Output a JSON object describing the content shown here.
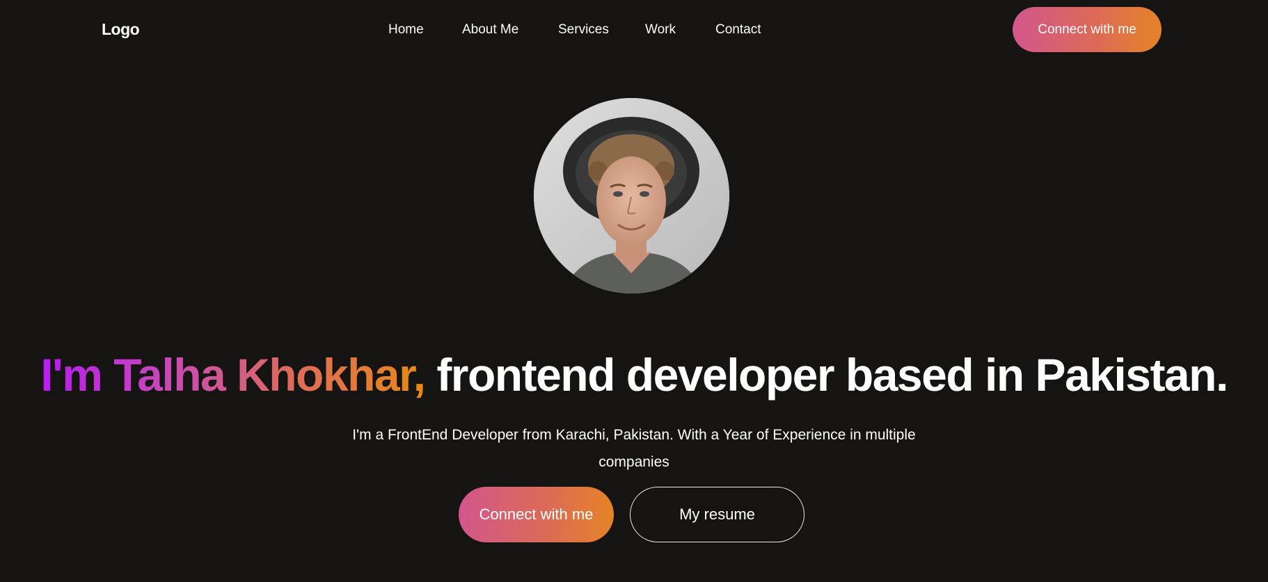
{
  "navbar": {
    "logo": "Logo",
    "links": [
      "Home",
      "About Me",
      "Services",
      "Work",
      "Contact"
    ],
    "cta_label": "Connect with me"
  },
  "hero": {
    "headline_highlight": "I'm Talha Khokhar,",
    "headline_rest": "frontend developer based in Pakistan.",
    "intro": "I'm a FrontEnd Developer from Karachi, Pakistan. With a Year of Experience in multiple companies",
    "primary_cta": "Connect with me",
    "secondary_cta": "My resume"
  },
  "colors": {
    "background": "#161413",
    "gradient_start": "#d2568c",
    "gradient_end": "#e58327",
    "headline_gradient_start": "#b71cf0",
    "headline_gradient_end": "#e88a14"
  }
}
